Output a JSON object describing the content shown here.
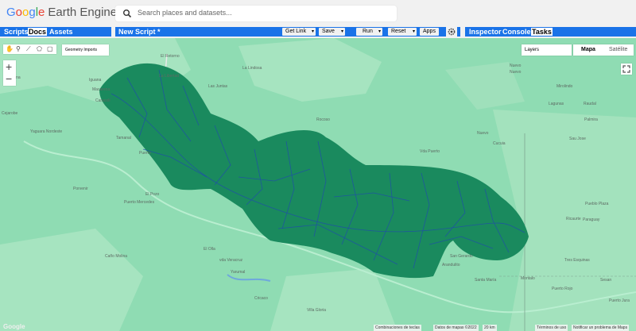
{
  "header": {
    "logo_google": [
      "G",
      "o",
      "o",
      "g",
      "l",
      "e"
    ],
    "logo_rest": "Earth Engine",
    "search_placeholder": "Search places and datasets..."
  },
  "left_tabs": [
    "Scripts",
    "Docs",
    "Assets"
  ],
  "active_left_tab": "Docs",
  "editor": {
    "script_title": "New Script *",
    "buttons": {
      "get_link": "Get Link",
      "save": "Save",
      "run": "Run",
      "reset": "Reset",
      "apps": "Apps"
    }
  },
  "right_tabs": [
    "Inspector",
    "Console",
    "Tasks"
  ],
  "active_right_tab": "Tasks",
  "map": {
    "geometry_imports": "Geometry Imports",
    "layers": "Layers",
    "map_type": [
      "Mapa",
      "Satélite"
    ],
    "zoom_in": "+",
    "zoom_out": "−",
    "google": "Google",
    "attribution": {
      "shortcuts": "Combinaciones de teclas",
      "data": "Datos de mapas ©2022",
      "scale": "20 km",
      "terms": "Términos de uso",
      "report": "Notificar un problema de Maps"
    },
    "places": [
      {
        "text": "El Retorno"
      },
      {
        "text": "La Libertad"
      },
      {
        "text": "La Lindosa"
      },
      {
        "text": "Las Juntas"
      },
      {
        "text": "Cacarena"
      },
      {
        "text": "Iguana"
      },
      {
        "text": "Nuevo"
      },
      {
        "text": "Raudal"
      },
      {
        "text": "Macarena"
      },
      {
        "text": "Mirolindo"
      },
      {
        "text": "Palmira"
      },
      {
        "text": "Nuevo"
      },
      {
        "text": "Lagunas"
      },
      {
        "text": "Caracolí"
      },
      {
        "text": "Cejarobe"
      },
      {
        "text": "Yaguara Nordeste"
      },
      {
        "text": "Tamanal"
      },
      {
        "text": "Puerto"
      },
      {
        "text": "Rocoso"
      },
      {
        "text": "Vda Puerto"
      },
      {
        "text": "Cucuia"
      },
      {
        "text": "Sau Jose"
      },
      {
        "text": "Nuevo"
      },
      {
        "text": "Porvenir"
      },
      {
        "text": "El Pozo"
      },
      {
        "text": "Puerto Mercedes"
      },
      {
        "text": "Caño Molina"
      },
      {
        "text": "El Olla"
      },
      {
        "text": "vda Veracruz"
      },
      {
        "text": "Yarumal"
      },
      {
        "text": "Cricaco"
      },
      {
        "text": "Villa Gloria"
      },
      {
        "text": "San Gerardo"
      },
      {
        "text": "Arandulito"
      },
      {
        "text": "Santa María"
      },
      {
        "text": "Montalo"
      },
      {
        "text": "Tres Esquinas"
      },
      {
        "text": "Puerto Jura"
      },
      {
        "text": "Ricaurte"
      },
      {
        "text": "Paraguay"
      },
      {
        "text": "Pueblo Plaza"
      },
      {
        "text": "Puerto Rojo"
      },
      {
        "text": "Sesan"
      }
    ]
  },
  "colors": {
    "blue_bar": "#1a73e8",
    "map_bg": "#8fdcb3",
    "basin": "#1a8a5e",
    "rivers": "#1f4fa8"
  }
}
